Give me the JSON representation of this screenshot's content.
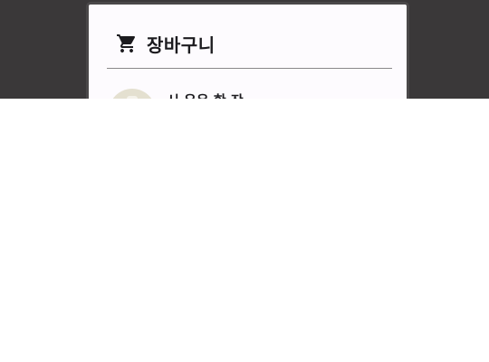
{
  "dialog": {
    "title": "장바구니",
    "title_icon": "shopping-cart-icon"
  },
  "items": [
    {
      "name": "시 우유 한 잔"
    }
  ],
  "colors": {
    "backdrop": "#3a3839",
    "dialog_bg": "#fdfbfe",
    "dialog_border": "#4a4849",
    "text": "#1c1b1f",
    "divider": "#8a888a",
    "avatar_bg": "#e4e0d0"
  }
}
